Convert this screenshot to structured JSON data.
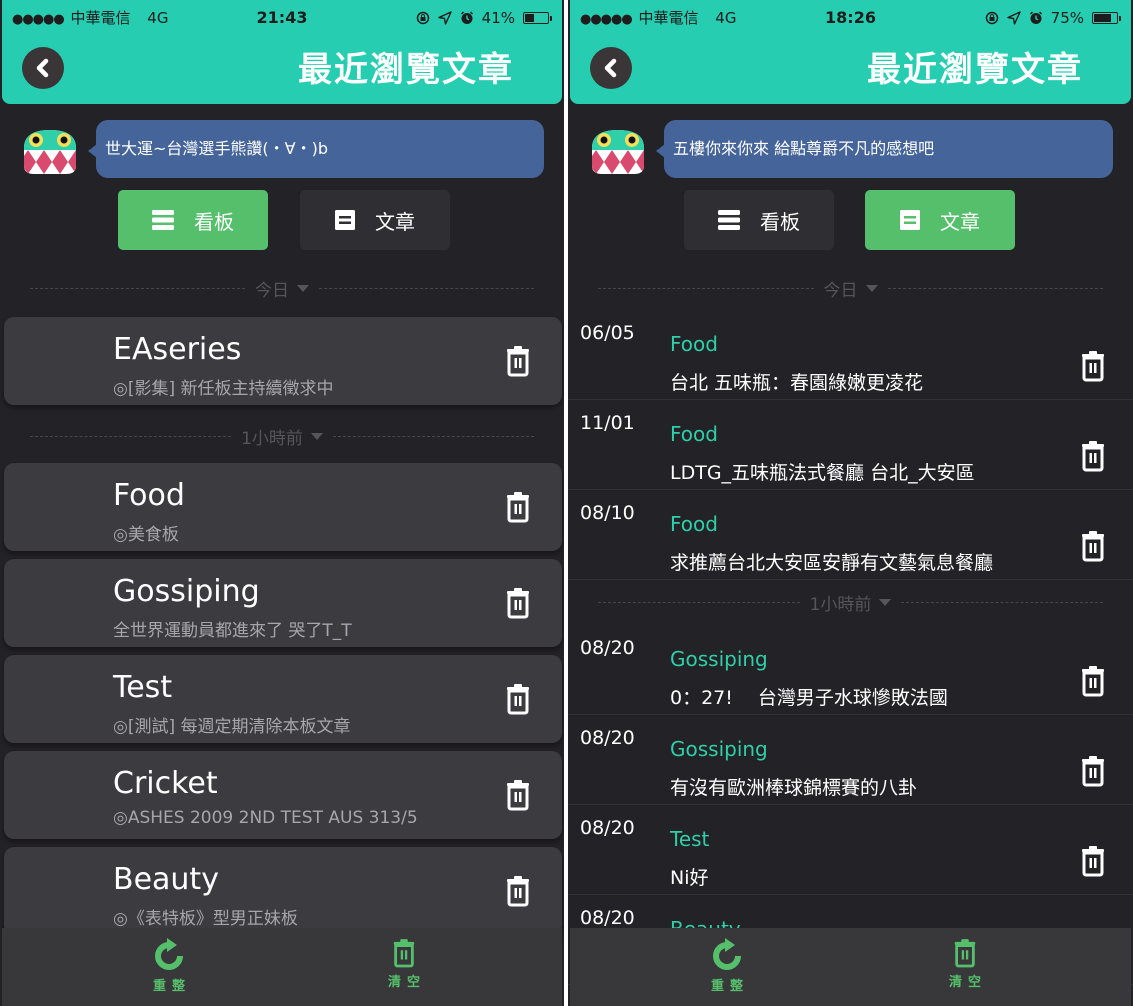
{
  "screens": [
    {
      "status": {
        "signal": "●●●●●",
        "carrier": "中華電信",
        "network": "4G",
        "time": "21:43",
        "battery_pct_label": "41%",
        "battery_level": 0.41
      },
      "header": {
        "title": "最近瀏覽文章",
        "back_icon": "chevron-left-icon"
      },
      "mascot_message": "世大運~台灣選手熊讚(・∀・)b",
      "toggle": {
        "boards_label": "看板",
        "articles_label": "文章",
        "active": "boards"
      },
      "sections": [
        {
          "label": "今日"
        },
        {
          "label": "1小時前"
        }
      ],
      "boards": [
        {
          "name": "EAseries",
          "desc": "◎[影集] 新任板主持續徵求中",
          "section": 0
        },
        {
          "name": "Food",
          "desc": "◎美食板",
          "section": 1
        },
        {
          "name": "Gossiping",
          "desc": "全世界運動員都進來了 哭了T_T",
          "section": 1
        },
        {
          "name": "Test",
          "desc": "◎[測試] 每週定期清除本板文章",
          "section": 1
        },
        {
          "name": "Cricket",
          "desc": "◎ASHES 2009 2ND TEST AUS 313/5",
          "section": 1
        },
        {
          "name": "Beauty",
          "desc": "◎《表特板》型男正妹板",
          "section": 1
        }
      ],
      "toolbar": {
        "refresh_label": "重整",
        "clear_label": "清空"
      }
    },
    {
      "status": {
        "signal": "●●●●●",
        "carrier": "中華電信",
        "network": "4G",
        "time": "18:26",
        "battery_pct_label": "75%",
        "battery_level": 0.75
      },
      "header": {
        "title": "最近瀏覽文章",
        "back_icon": "chevron-left-icon"
      },
      "mascot_message": "五樓你來你來 給點尊爵不凡的感想吧",
      "toggle": {
        "boards_label": "看板",
        "articles_label": "文章",
        "active": "articles"
      },
      "sections": [
        {
          "label": "今日"
        },
        {
          "label": "1小時前"
        }
      ],
      "articles": [
        {
          "date": "06/05",
          "board": "Food",
          "title": "台北 五味瓶：春園綠嫩更凌花",
          "section": 0
        },
        {
          "date": "11/01",
          "board": "Food",
          "title": "LDTG_五味瓶法式餐廳  台北_大安區",
          "section": 0
        },
        {
          "date": "08/10",
          "board": "Food",
          "title": "求推薦台北大安區安靜有文藝氣息餐廳",
          "section": 0
        },
        {
          "date": "08/20",
          "board": "Gossiping",
          "title": "0：27!　 台灣男子水球慘敗法國",
          "section": 1
        },
        {
          "date": "08/20",
          "board": "Gossiping",
          "title": "有沒有歐洲棒球錦標賽的八卦",
          "section": 1
        },
        {
          "date": "08/20",
          "board": "Test",
          "title": "Ni好",
          "section": 1
        },
        {
          "date": "08/20",
          "board": "Beauty",
          "title": "",
          "section": 1
        }
      ],
      "toolbar": {
        "refresh_label": "重整",
        "clear_label": "清空"
      }
    }
  ],
  "colors": {
    "header_bg": "#27cdb0",
    "active_toggle": "#55bf6c",
    "board_accent": "#2ecfa9",
    "bubble_bg": "#45659a",
    "screen_bg": "#232226",
    "card_bg": "#3b3b40"
  }
}
